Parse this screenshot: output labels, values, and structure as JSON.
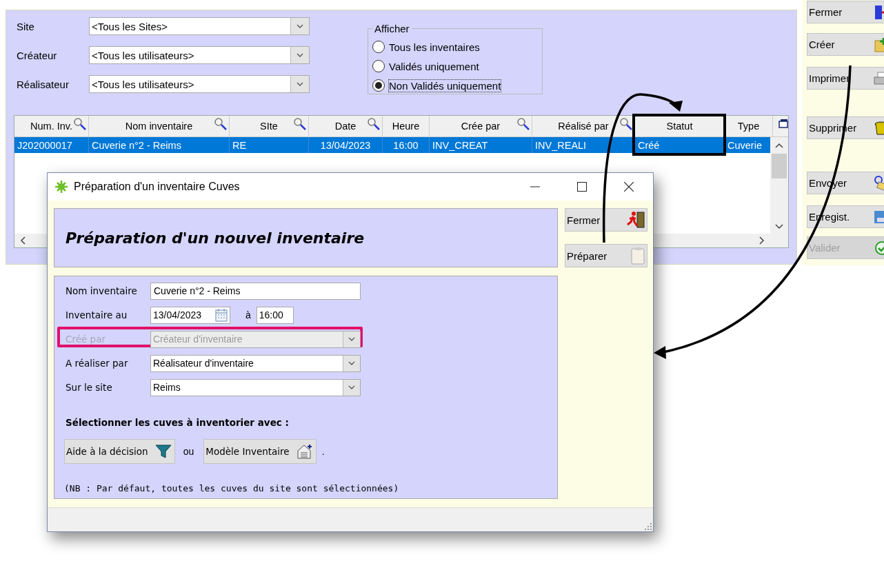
{
  "main_window": {
    "filters": [
      {
        "label": "Site",
        "value": "<Tous les Sites>"
      },
      {
        "label": "Créateur",
        "value": "<Tous les utilisateurs>"
      },
      {
        "label": "Réalisateur",
        "value": "<Tous les utilisateurs>"
      }
    ],
    "display_group": {
      "title": "Afficher",
      "options": [
        {
          "label": "Tous les inventaires",
          "selected": false
        },
        {
          "label": "Validés uniquement",
          "selected": false
        },
        {
          "label": "Non Validés uniquement",
          "selected": true
        }
      ]
    },
    "table": {
      "columns": [
        {
          "label": "Num. Inv.",
          "searchable": true,
          "highlighted": false
        },
        {
          "label": "Nom inventaire",
          "searchable": true,
          "highlighted": false
        },
        {
          "label": "SIte",
          "searchable": true,
          "highlighted": false
        },
        {
          "label": "Date",
          "searchable": true,
          "highlighted": false
        },
        {
          "label": "Heure",
          "searchable": false,
          "highlighted": false
        },
        {
          "label": "Crée par",
          "searchable": true,
          "highlighted": false
        },
        {
          "label": "Réalisé par",
          "searchable": true,
          "highlighted": false
        },
        {
          "label": "Statut",
          "searchable": false,
          "highlighted": true
        },
        {
          "label": "Type",
          "searchable": false,
          "highlighted": false
        }
      ],
      "rows": [
        {
          "selected": true,
          "cells": [
            "J202000017",
            "Cuverie n°2 - Reims",
            "RE",
            "13/04/2023",
            "16:00",
            "INV_CREAT",
            "INV_REALI",
            "Créé",
            "Cuverie"
          ]
        }
      ]
    },
    "buttons": [
      {
        "label": "Fermer",
        "kind": "close",
        "disabled": false
      },
      {
        "label": "Créer",
        "kind": "create",
        "disabled": false
      },
      {
        "label": "Imprimer",
        "kind": "print",
        "disabled": false
      },
      {
        "label": "Supprimer",
        "kind": "delete",
        "disabled": false
      },
      {
        "label": "Envoyer",
        "kind": "send",
        "disabled": false
      },
      {
        "label": "Enregist.",
        "kind": "save",
        "disabled": false
      },
      {
        "label": "Valider",
        "kind": "validate",
        "disabled": true
      }
    ]
  },
  "dialog": {
    "title": "Préparation d'un inventaire Cuves",
    "heading": "Préparation d'un nouvel inventaire",
    "fields": [
      {
        "kind": "text",
        "label": "Nom inventaire",
        "value": "Cuverie n°2 - Reims",
        "disabled": false,
        "highlighted": false
      },
      {
        "kind": "datetime",
        "label": "Inventaire au",
        "value": "13/04/2023",
        "joiner": "à",
        "time": "16:00",
        "disabled": false,
        "highlighted": false
      },
      {
        "kind": "combo",
        "label": "Créé par",
        "value": "Créateur d'inventaire",
        "disabled": true,
        "highlighted": true
      },
      {
        "kind": "combo",
        "label": "A réaliser par",
        "value": "Réalisateur d'inventaire",
        "disabled": false,
        "highlighted": false
      },
      {
        "kind": "combo",
        "label": "Sur le site",
        "value": "Reims",
        "disabled": false,
        "highlighted": false
      }
    ],
    "selection": {
      "title": "Sélectionner les cuves à inventorier avec :",
      "buttons": [
        {
          "label": "Aide à la décision",
          "kind": "funnel"
        },
        {
          "label": "Modèle Inventaire",
          "kind": "template"
        }
      ],
      "joiner": "ou",
      "trailer": "."
    },
    "note": "(NB : Par défaut, toutes les cuves du site sont sélectionnées)",
    "buttons": [
      {
        "label": "Fermer",
        "kind": "exit"
      },
      {
        "label": "Préparer",
        "kind": "prepare"
      }
    ]
  }
}
